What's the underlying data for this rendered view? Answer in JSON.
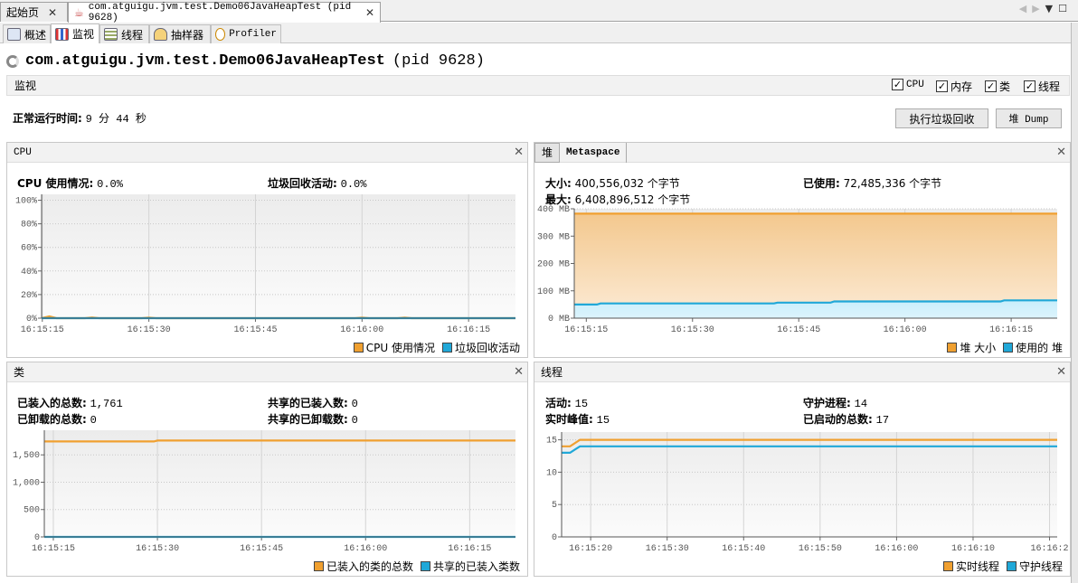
{
  "doc_tabs": [
    {
      "label": "起始页",
      "active": false
    },
    {
      "label": "com.atguigu.jvm.test.Demo06JavaHeapTest (pid 9628)",
      "active": true
    }
  ],
  "sub_tabs": [
    {
      "label": "概述",
      "icon": "overview-icon"
    },
    {
      "label": "监视",
      "icon": "monitor-chart-icon"
    },
    {
      "label": "线程",
      "icon": "threads-icon"
    },
    {
      "label": "抽样器",
      "icon": "sampler-icon"
    },
    {
      "label": "Profiler",
      "icon": "profiler-clock-icon"
    }
  ],
  "app": {
    "name": "com.atguigu.jvm.test.Demo06JavaHeapTest",
    "pid": "(pid 9628)"
  },
  "monitor": {
    "title": "监视",
    "checkboxes": [
      {
        "label": "CPU",
        "checked": true
      },
      {
        "label": "内存",
        "checked": true
      },
      {
        "label": "类",
        "checked": true
      },
      {
        "label": "线程",
        "checked": true
      }
    ]
  },
  "uptime": {
    "label": "正常运行时间:",
    "value": "9 分 44 秒"
  },
  "buttons": {
    "gc": "执行垃圾回收",
    "heap_dump": "堆 Dump"
  },
  "colors": {
    "orange": "#f0a030",
    "blue": "#20a8d8"
  },
  "cpu_panel": {
    "title": "CPU",
    "usage_label": "CPU 使用情况:",
    "usage_value": "0.0%",
    "gc_label": "垃圾回收活动:",
    "gc_value": "0.0%"
  },
  "heap_panel": {
    "tabs": [
      "堆",
      "Metaspace"
    ],
    "size_label": "大小:",
    "size_value": "400,556,032 个字节",
    "used_label": "已使用:",
    "used_value": "72,485,336 个字节",
    "max_label": "最大:",
    "max_value": "6,408,896,512 个字节"
  },
  "classes_panel": {
    "title": "类",
    "loaded_label": "已装入的总数:",
    "loaded_value": "1,761",
    "unloaded_label": "已卸载的总数:",
    "unloaded_value": "0",
    "shared_loaded_label": "共享的已装入数:",
    "shared_loaded_value": "0",
    "shared_unloaded_label": "共享的已卸载数:",
    "shared_unloaded_value": "0"
  },
  "threads_panel": {
    "title": "线程",
    "live_label": "活动:",
    "live_value": "15",
    "daemon_label": "守护进程:",
    "daemon_value": "14",
    "peak_label": "实时峰值:",
    "peak_value": "15",
    "started_label": "已启动的总数:",
    "started_value": "17"
  },
  "chart_data": [
    {
      "id": "cpu",
      "type": "line",
      "xlim": [
        "16:15:14.9",
        "16:16:21.6"
      ],
      "ylim": [
        0,
        105
      ],
      "yticks": [
        0,
        20,
        40,
        60,
        80,
        100
      ],
      "ytick_labels": [
        "0%",
        "20%",
        "40%",
        "60%",
        "80%",
        "100%"
      ],
      "xticks": [
        "16:15:15",
        "16:15:30",
        "16:15:45",
        "16:16:00",
        "16:16:15"
      ],
      "series": [
        {
          "name": "CPU 使用情况",
          "color": "#f0a030",
          "fill": false,
          "points": [
            [
              "16:15:14.9",
              0
            ],
            [
              "16:15:16",
              1.5
            ],
            [
              "16:15:17",
              0
            ],
            [
              "16:15:21",
              0
            ],
            [
              "16:15:22",
              0.6
            ],
            [
              "16:15:23",
              0
            ],
            [
              "16:15:29",
              0
            ],
            [
              "16:15:30",
              0.5
            ],
            [
              "16:15:31",
              0
            ],
            [
              "16:15:59",
              0
            ],
            [
              "16:16:00",
              0.5
            ],
            [
              "16:16:01",
              0
            ],
            [
              "16:16:05",
              0
            ],
            [
              "16:16:06",
              0.5
            ],
            [
              "16:16:07",
              0
            ],
            [
              "16:16:21.6",
              0
            ]
          ]
        },
        {
          "name": "垃圾回收活动",
          "color": "#20a8d8",
          "fill": false,
          "points": [
            [
              "16:15:14.9",
              0
            ],
            [
              "16:16:21.6",
              0
            ]
          ]
        }
      ]
    },
    {
      "id": "heap",
      "type": "area",
      "xlim": [
        "16:15:13.3",
        "16:16:21.5"
      ],
      "ylim": [
        0,
        400
      ],
      "unit": "MB",
      "yticks": [
        0,
        100,
        200,
        300,
        400
      ],
      "ytick_labels": [
        "0 MB",
        "100 MB",
        "200 MB",
        "300 MB",
        "400 MB"
      ],
      "xticks": [
        "16:15:15",
        "16:15:30",
        "16:15:45",
        "16:16:00",
        "16:16:15"
      ],
      "series": [
        {
          "name": "堆 大小",
          "color": "#f0a030",
          "fill": true,
          "points": [
            [
              "16:15:13.3",
              382
            ],
            [
              "16:16:21.5",
              382
            ]
          ]
        },
        {
          "name": "使用的 堆",
          "color": "#20a8d8",
          "fill": true,
          "points": [
            [
              "16:15:13.3",
              50
            ],
            [
              "16:15:16.5",
              50
            ],
            [
              "16:15:17",
              54
            ],
            [
              "16:15:41.5",
              54
            ],
            [
              "16:15:42",
              57
            ],
            [
              "16:15:49.5",
              57
            ],
            [
              "16:15:50",
              61
            ],
            [
              "16:16:13.5",
              61
            ],
            [
              "16:16:14",
              65
            ],
            [
              "16:16:21.5",
              65
            ]
          ]
        }
      ]
    },
    {
      "id": "classes",
      "type": "line",
      "xlim": [
        "16:15:13.7",
        "16:16:21.6"
      ],
      "ylim": [
        0,
        1950
      ],
      "yticks": [
        0,
        500,
        1000,
        1500
      ],
      "ytick_labels": [
        "0",
        "500",
        "1,000",
        "1,500"
      ],
      "xticks": [
        "16:15:15",
        "16:15:30",
        "16:15:45",
        "16:16:00",
        "16:16:15"
      ],
      "series": [
        {
          "name": "已装入的类的总数",
          "color": "#f0a030",
          "fill": false,
          "points": [
            [
              "16:15:13.7",
              1745
            ],
            [
              "16:15:29.5",
              1745
            ],
            [
              "16:15:30",
              1761
            ],
            [
              "16:16:21.6",
              1761
            ]
          ]
        },
        {
          "name": "共享的已装入类数",
          "color": "#20a8d8",
          "fill": false,
          "points": [
            [
              "16:15:13.7",
              0
            ],
            [
              "16:16:21.6",
              0
            ]
          ]
        }
      ]
    },
    {
      "id": "threads",
      "type": "line",
      "xlim": [
        "16:15:16.2",
        "16:16:21"
      ],
      "ylim": [
        0,
        16.2
      ],
      "yticks": [
        0,
        5,
        10,
        15
      ],
      "ytick_labels": [
        "0",
        "5",
        "10",
        "15"
      ],
      "xticks": [
        "16:15:20",
        "16:15:30",
        "16:15:40",
        "16:15:50",
        "16:16:00",
        "16:16:10",
        "16:16:20"
      ],
      "xtick_labels": [
        "16:15:20",
        "16:15:30",
        "16:15:40",
        "16:15:50",
        "16:16:00",
        "16:16:10",
        "16:16:2"
      ],
      "series": [
        {
          "name": "实时线程",
          "color": "#f0a030",
          "fill": false,
          "points": [
            [
              "16:15:16.2",
              14
            ],
            [
              "16:15:17.3",
              14
            ],
            [
              "16:15:18.6",
              15
            ],
            [
              "16:16:21",
              15
            ]
          ]
        },
        {
          "name": "守护线程",
          "color": "#20a8d8",
          "fill": false,
          "points": [
            [
              "16:15:16.2",
              13
            ],
            [
              "16:15:17.3",
              13
            ],
            [
              "16:15:18.6",
              14
            ],
            [
              "16:16:21",
              14
            ]
          ]
        }
      ]
    }
  ]
}
